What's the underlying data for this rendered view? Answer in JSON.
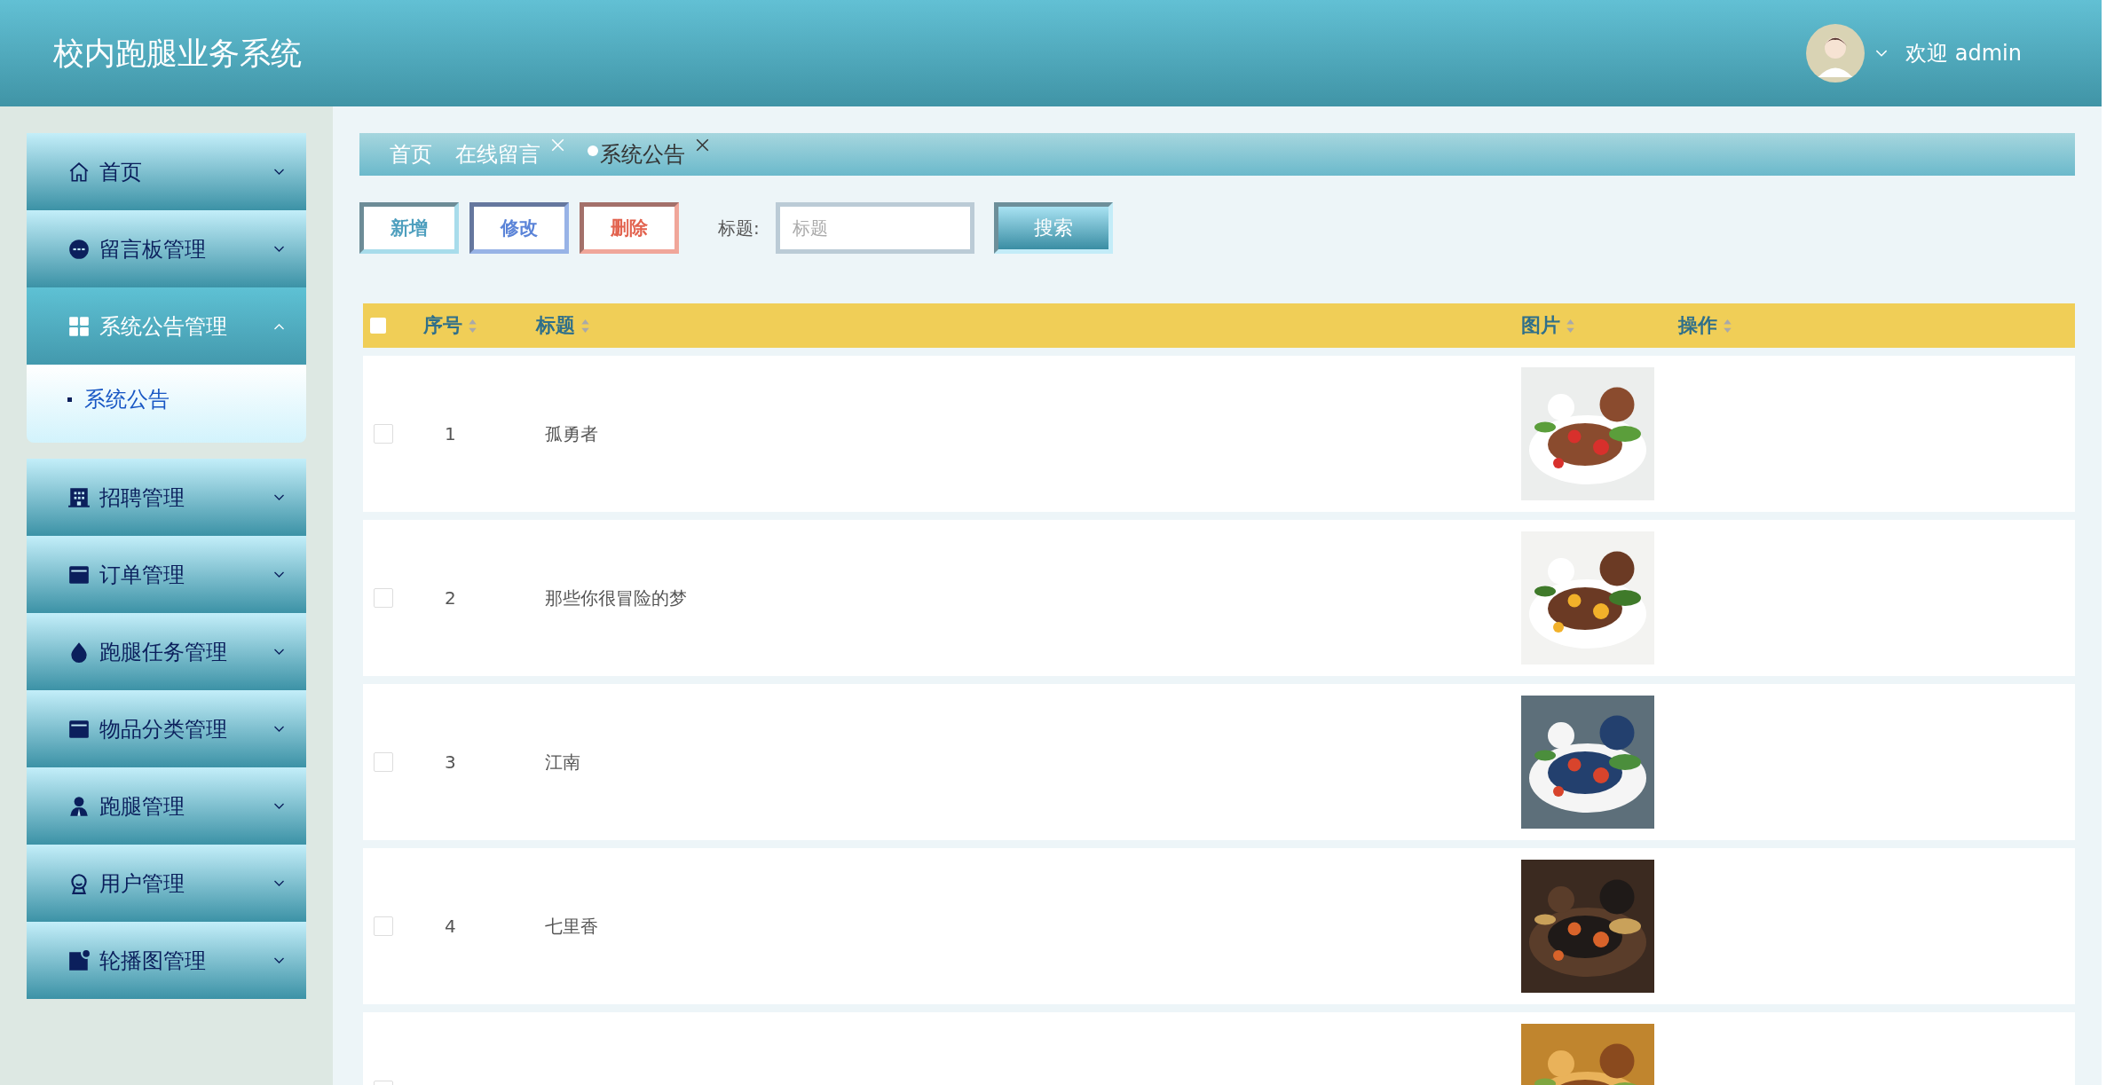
{
  "header": {
    "title": "校内跑腿业务系统",
    "welcome": "欢迎 admin"
  },
  "sidebar": {
    "items": [
      {
        "label": "首页",
        "expanded": false
      },
      {
        "label": "留言板管理",
        "expanded": false
      },
      {
        "label": "系统公告管理",
        "expanded": true,
        "children": [
          {
            "label": "系统公告",
            "selected": true
          }
        ]
      },
      {
        "label": "招聘管理",
        "expanded": false
      },
      {
        "label": "订单管理",
        "expanded": false
      },
      {
        "label": "跑腿任务管理",
        "expanded": false
      },
      {
        "label": "物品分类管理",
        "expanded": false
      },
      {
        "label": "跑腿管理",
        "expanded": false
      },
      {
        "label": "用户管理",
        "expanded": false
      },
      {
        "label": "轮播图管理",
        "expanded": false
      }
    ]
  },
  "tabs": [
    {
      "label": "首页",
      "closable": false,
      "selected": false
    },
    {
      "label": "在线留言",
      "closable": true,
      "selected": false
    },
    {
      "label": "系统公告",
      "closable": true,
      "selected": true
    }
  ],
  "toolbar": {
    "buttons": [
      {
        "label": "新增",
        "kind": "add"
      },
      {
        "label": "修改",
        "kind": "edit"
      },
      {
        "label": "删除",
        "kind": "delete"
      }
    ],
    "search_label": "标题:",
    "search": {
      "placeholder": "标题"
    },
    "search_button": "搜索"
  },
  "table": {
    "select_all": {
      "checked": false
    },
    "columns": [
      "序号",
      "标题",
      "图片",
      "操作"
    ],
    "rows": [
      {
        "index": "1",
        "title": "孤勇者",
        "checked": false
      },
      {
        "index": "2",
        "title": "那些你很冒险的梦",
        "checked": false
      },
      {
        "index": "3",
        "title": "江南",
        "checked": false
      },
      {
        "index": "4",
        "title": "七里香",
        "checked": false
      },
      {
        "checked": false
      }
    ]
  }
}
